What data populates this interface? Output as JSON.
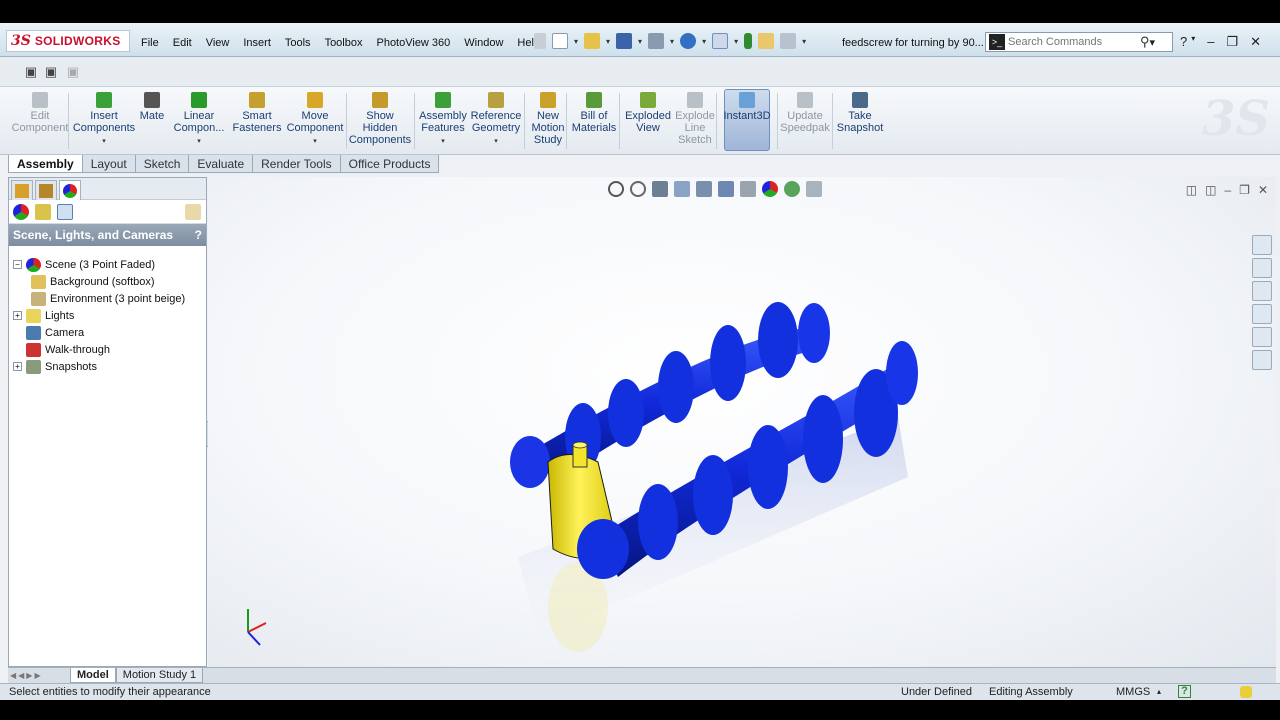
{
  "app": {
    "logo_mark": "3S",
    "logo_text": "SOLIDWORKS",
    "document_title": "feedscrew for turning by 90..."
  },
  "menu": [
    "File",
    "Edit",
    "View",
    "Insert",
    "Tools",
    "Toolbox",
    "PhotoView 360",
    "Window",
    "Help"
  ],
  "search": {
    "placeholder": "Search Commands"
  },
  "command_manager": [
    {
      "label": "Edit\nComponent",
      "icon": "edit-component-icon",
      "enabled": false
    },
    {
      "label": "Insert\nComponents",
      "icon": "insert-components-icon",
      "enabled": true
    },
    {
      "label": "Mate",
      "icon": "mate-icon",
      "enabled": true
    },
    {
      "label": "Linear\nCompon...",
      "icon": "linear-pattern-icon",
      "enabled": true
    },
    {
      "label": "Smart\nFasteners",
      "icon": "smart-fasteners-icon",
      "enabled": true
    },
    {
      "label": "Move\nComponent",
      "icon": "move-component-icon",
      "enabled": true
    },
    {
      "label": "Show\nHidden\nComponents",
      "icon": "show-hidden-icon",
      "enabled": true
    },
    {
      "label": "Assembly\nFeatures",
      "icon": "assembly-features-icon",
      "enabled": true
    },
    {
      "label": "Reference\nGeometry",
      "icon": "reference-geometry-icon",
      "enabled": true
    },
    {
      "label": "New\nMotion\nStudy",
      "icon": "motion-study-icon",
      "enabled": true
    },
    {
      "label": "Bill of\nMaterials",
      "icon": "bom-icon",
      "enabled": true
    },
    {
      "label": "Exploded\nView",
      "icon": "exploded-view-icon",
      "enabled": true
    },
    {
      "label": "Explode\nLine\nSketch",
      "icon": "explode-line-icon",
      "enabled": false
    },
    {
      "label": "Instant3D",
      "icon": "instant3d-icon",
      "enabled": true
    },
    {
      "label": "Update\nSpeedpak",
      "icon": "speedpak-icon",
      "enabled": false
    },
    {
      "label": "Take\nSnapshot",
      "icon": "snapshot-icon",
      "enabled": true
    }
  ],
  "tabs": [
    "Assembly",
    "Layout",
    "Sketch",
    "Evaluate",
    "Render Tools",
    "Office Products"
  ],
  "panel": {
    "title": "Scene, Lights, and Cameras",
    "help": "?",
    "tree": [
      {
        "label": "Scene (3 Point Faded)",
        "level": 1,
        "expander": "−"
      },
      {
        "label": "Background (softbox)",
        "level": 2,
        "expander": ""
      },
      {
        "label": "Environment (3 point beige)",
        "level": 2,
        "expander": ""
      },
      {
        "label": "Lights",
        "level": 1,
        "expander": "+"
      },
      {
        "label": "Camera",
        "level": 1,
        "expander": ""
      },
      {
        "label": "Walk-through",
        "level": 1,
        "expander": ""
      },
      {
        "label": "Snapshots",
        "level": 1,
        "expander": "+"
      }
    ]
  },
  "bottom_tabs": [
    "Model",
    "Motion Study 1"
  ],
  "status": {
    "hint": "Select entities to modify their appearance",
    "state": "Under Defined",
    "mode": "Editing Assembly",
    "units": "MMGS",
    "units_caret": "▴",
    "help": "?"
  },
  "colors": {
    "screw": "#1028d8",
    "motor": "#f2e52a",
    "accent": "#c8102e"
  }
}
